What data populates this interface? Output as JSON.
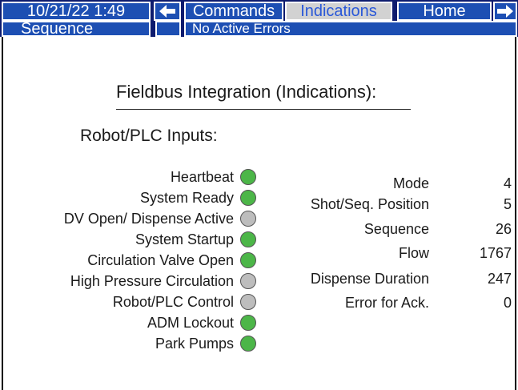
{
  "header": {
    "datetime": "10/21/22 1:49",
    "commands_label": "Commands",
    "indications_label": "Indications",
    "home_label": "Home",
    "sequence_label": "Sequence",
    "status_text": "No Active Errors",
    "back_icon": "arrow-left-icon",
    "forward_icon": "arrow-right-icon"
  },
  "colors": {
    "bar": "#0d1b6e",
    "button": "#1d4fb3",
    "active_button": "#d2d2d2",
    "led_on": "#4cb648",
    "led_off": "#bdbdbd"
  },
  "main": {
    "title": "Fieldbus Integration (Indications):",
    "subtitle": "Robot/PLC Inputs:",
    "inputs": [
      {
        "label": "Heartbeat",
        "active": true
      },
      {
        "label": "System Ready",
        "active": true
      },
      {
        "label": "DV Open/ Dispense Active",
        "active": false
      },
      {
        "label": "System Startup",
        "active": true
      },
      {
        "label": "Circulation Valve Open",
        "active": true
      },
      {
        "label": "High Pressure Circulation",
        "active": false
      },
      {
        "label": "Robot/PLC Control",
        "active": false
      },
      {
        "label": "ADM Lockout",
        "active": true
      },
      {
        "label": "Park Pumps",
        "active": true
      }
    ],
    "status": [
      {
        "label": "Mode",
        "value": "4"
      },
      {
        "label": "Shot/Seq. Position",
        "value": "5"
      },
      {
        "label": "Sequence",
        "value": "26"
      },
      {
        "label": "Flow",
        "value": "1767"
      },
      {
        "label": "Dispense Duration",
        "value": "247"
      },
      {
        "label": "Error for Ack.",
        "value": "0"
      }
    ]
  }
}
